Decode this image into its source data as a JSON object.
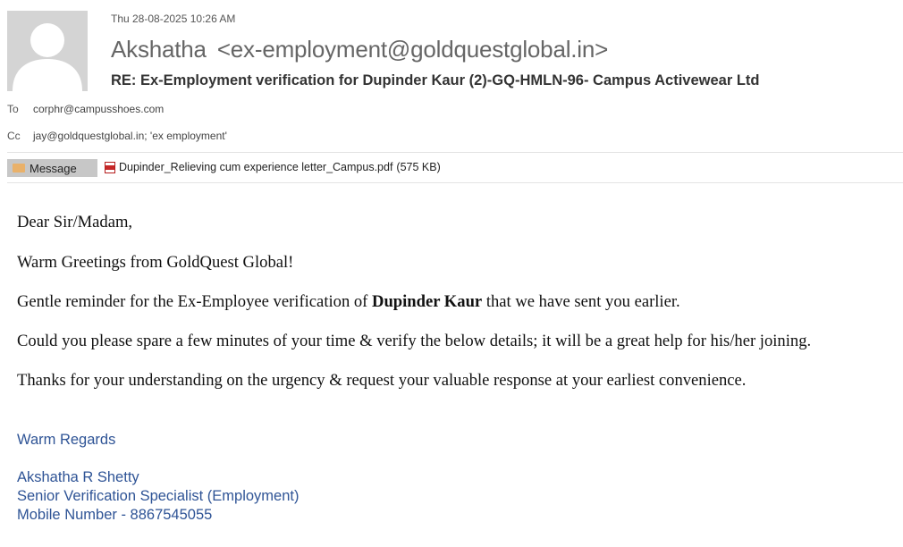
{
  "header": {
    "date": "Thu 28-08-2025 10:26 AM",
    "sender_name": "Akshatha",
    "sender_address": "<ex-employment@goldquestglobal.in>",
    "subject": "RE: Ex-Employment verification for Dupinder Kaur (2)-GQ-HMLN-96-  Campus Activewear Ltd",
    "to_label": "To",
    "to_value": "corphr@campusshoes.com",
    "cc_label": "Cc",
    "cc_value": "jay@goldquestglobal.in; 'ex employment'"
  },
  "tabs": {
    "message_label": "Message",
    "message_icon": "envelope-icon"
  },
  "attachment": {
    "icon": "pdf-icon",
    "filename": "Dupinder_Relieving cum experience letter_Campus.pdf",
    "size": "(575 KB)"
  },
  "body": {
    "greeting": "Dear Sir/Madam,",
    "line1": "Warm Greetings from GoldQuest Global!",
    "line2_before": "Gentle reminder for the Ex-Employee verification of ",
    "line2_bold": "Dupinder Kaur",
    "line2_after": " that we have sent you earlier.",
    "line3": "Could you please spare a few minutes of your time & verify the below details; it will be a great help for his/her joining.",
    "line4": "Thanks for your understanding on the urgency & request your valuable response at your earliest convenience."
  },
  "signature": {
    "closing": "Warm Regards",
    "name": "Akshatha R Shetty",
    "title": "Senior Verification Specialist (Employment)",
    "mobile": "Mobile Number - 8867545055"
  },
  "colors": {
    "signature": "#2f5496",
    "tab_background": "#c7c7c7",
    "avatar_background": "#d4d4d4"
  }
}
